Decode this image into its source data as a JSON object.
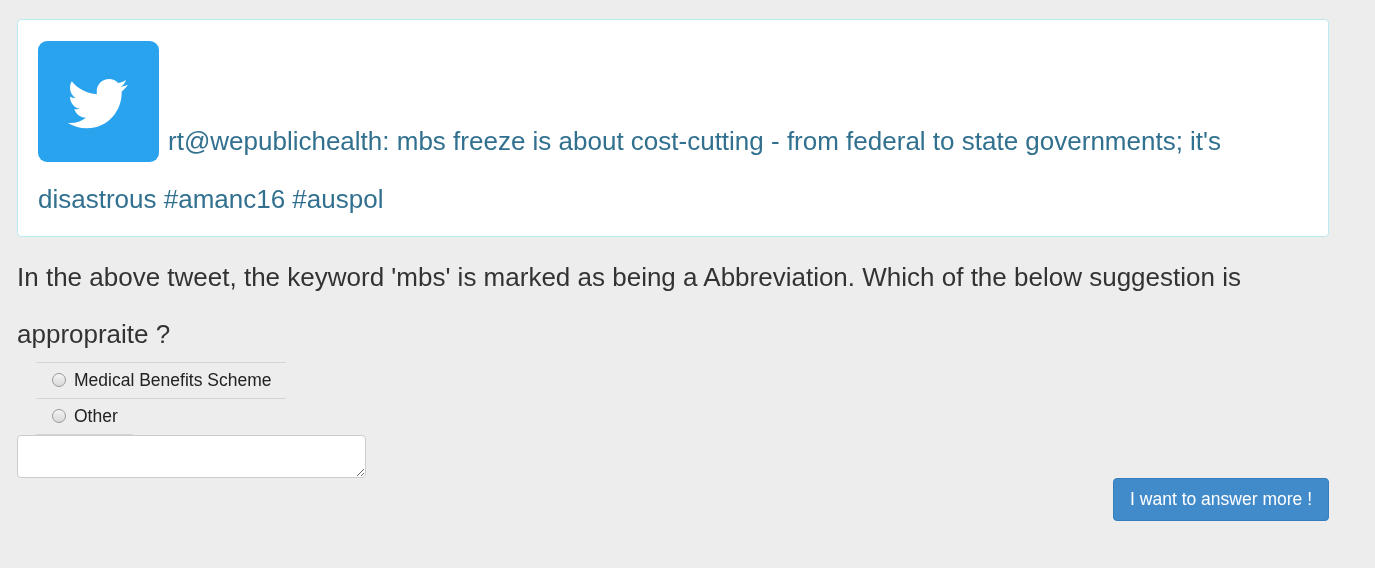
{
  "tweet": {
    "text": "rt@wepublichealth: mbs freeze is about cost-cutting - from federal to state governments; it's disastrous #amanc16 #auspol"
  },
  "question": "In the above tweet, the keyword 'mbs' is marked as being a Abbreviation. Which of the below suggestion is appropraite ?",
  "options": [
    {
      "label": "Medical Benefits Scheme",
      "selected": false
    },
    {
      "label": "Other",
      "selected": false
    }
  ],
  "answer_box": {
    "kind": "textarea"
  },
  "button": "I want to answer more !"
}
